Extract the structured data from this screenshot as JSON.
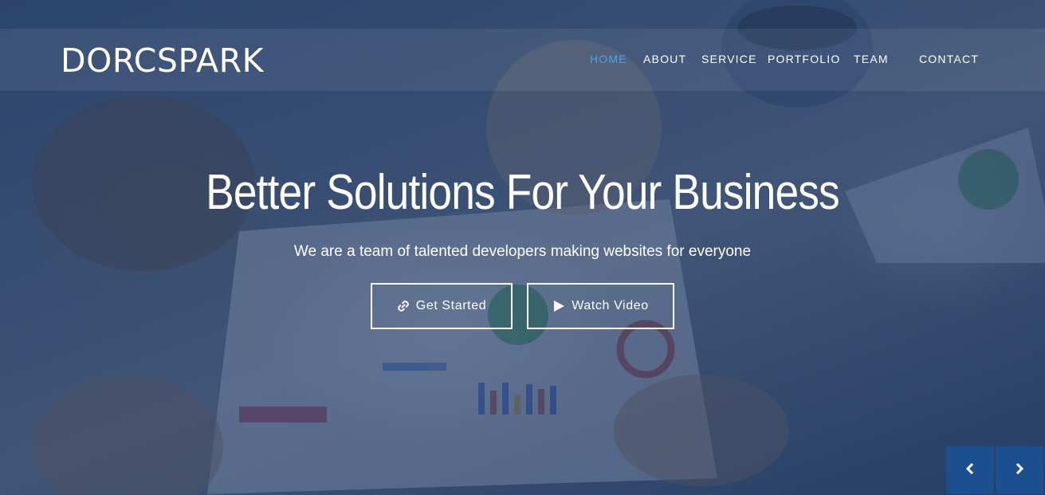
{
  "brand": {
    "name": "DORCSPARK"
  },
  "nav": {
    "items": [
      {
        "label": "HOME",
        "active": true
      },
      {
        "label": "ABOUT",
        "active": false
      },
      {
        "label": "SERVICE",
        "active": false
      },
      {
        "label": "PORTFOLIO",
        "active": false
      },
      {
        "label": "TEAM",
        "active": false
      },
      {
        "label": "CONTACT",
        "active": false
      }
    ]
  },
  "hero": {
    "headline": "Better Solutions For Your Business",
    "subline": "We are a team of talented developers making websites for everyone",
    "buttons": [
      {
        "label": "Get Started",
        "icon": "link-icon"
      },
      {
        "label": "Watch Video",
        "icon": "play-icon"
      }
    ]
  },
  "carousel": {
    "prev_icon": "chevron-left-icon",
    "next_icon": "chevron-right-icon"
  },
  "colors": {
    "accent": "#4aa3f0",
    "overlay": "#1c3462",
    "arrow_bg": "#1b4f8f"
  }
}
